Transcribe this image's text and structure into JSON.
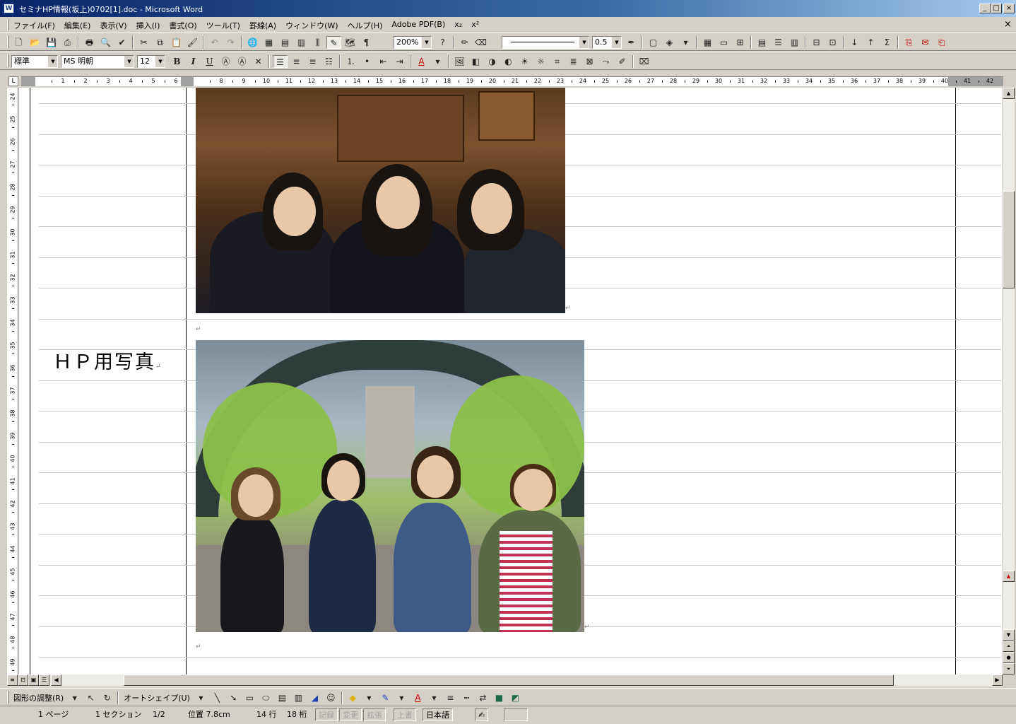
{
  "window": {
    "title": "セミナHP情報(坂上)0702[1].doc - Microsoft Word",
    "app_icon": "W",
    "minimize": "_",
    "maximize": "□",
    "close": "×"
  },
  "menu": {
    "items": [
      "ファイル(F)",
      "編集(E)",
      "表示(V)",
      "挿入(I)",
      "書式(O)",
      "ツール(T)",
      "罫線(A)",
      "ウィンドウ(W)",
      "ヘルプ(H)",
      "Adobe PDF(B)",
      "x₂",
      "x²"
    ],
    "close_doc": "×"
  },
  "standard_toolbar": {
    "zoom": "200%",
    "line_weight": "0.5"
  },
  "formatting_toolbar": {
    "style": "標準",
    "font": "MS 明朝",
    "size": "12",
    "bold": "B",
    "italic": "I",
    "underline": "U",
    "font_color_label": "A"
  },
  "ruler": {
    "numbers": [
      "1",
      "2",
      "3",
      "4",
      "5",
      "6",
      "8",
      "9",
      "10",
      "11",
      "12",
      "13",
      "14",
      "15",
      "16",
      "17",
      "18",
      "19",
      "20",
      "21",
      "22",
      "23",
      "24",
      "25",
      "26",
      "27",
      "28",
      "29",
      "30",
      "31",
      "32",
      "33",
      "34",
      "35",
      "36",
      "37",
      "38",
      "39",
      "40",
      "41",
      "42"
    ],
    "vertical_numbers": [
      "24",
      "25",
      "26",
      "27",
      "28",
      "29",
      "30",
      "31",
      "32",
      "33",
      "34",
      "35",
      "36",
      "37",
      "38",
      "39",
      "40",
      "41",
      "42",
      "43",
      "44",
      "45",
      "46",
      "47",
      "48",
      "49"
    ],
    "corner": "L"
  },
  "document": {
    "label": "ＨＰ用写真",
    "para_mark": "↵"
  },
  "drawing_toolbar": {
    "adjust": "図形の調整(R)",
    "autoshape": "オートシェイプ(U)"
  },
  "status": {
    "page": "1 ページ",
    "section": "1 セクション",
    "pages": "1/2",
    "position": "位置 7.8cm",
    "line": "14 行",
    "column": "18 桁",
    "rec": "記録",
    "trk": "変更",
    "ext": "拡張",
    "ovr": "上書",
    "language": "日本語"
  },
  "colors": {
    "title_start": "#0a246a",
    "title_end": "#a6caf0",
    "chrome": "#d4d0c8"
  }
}
